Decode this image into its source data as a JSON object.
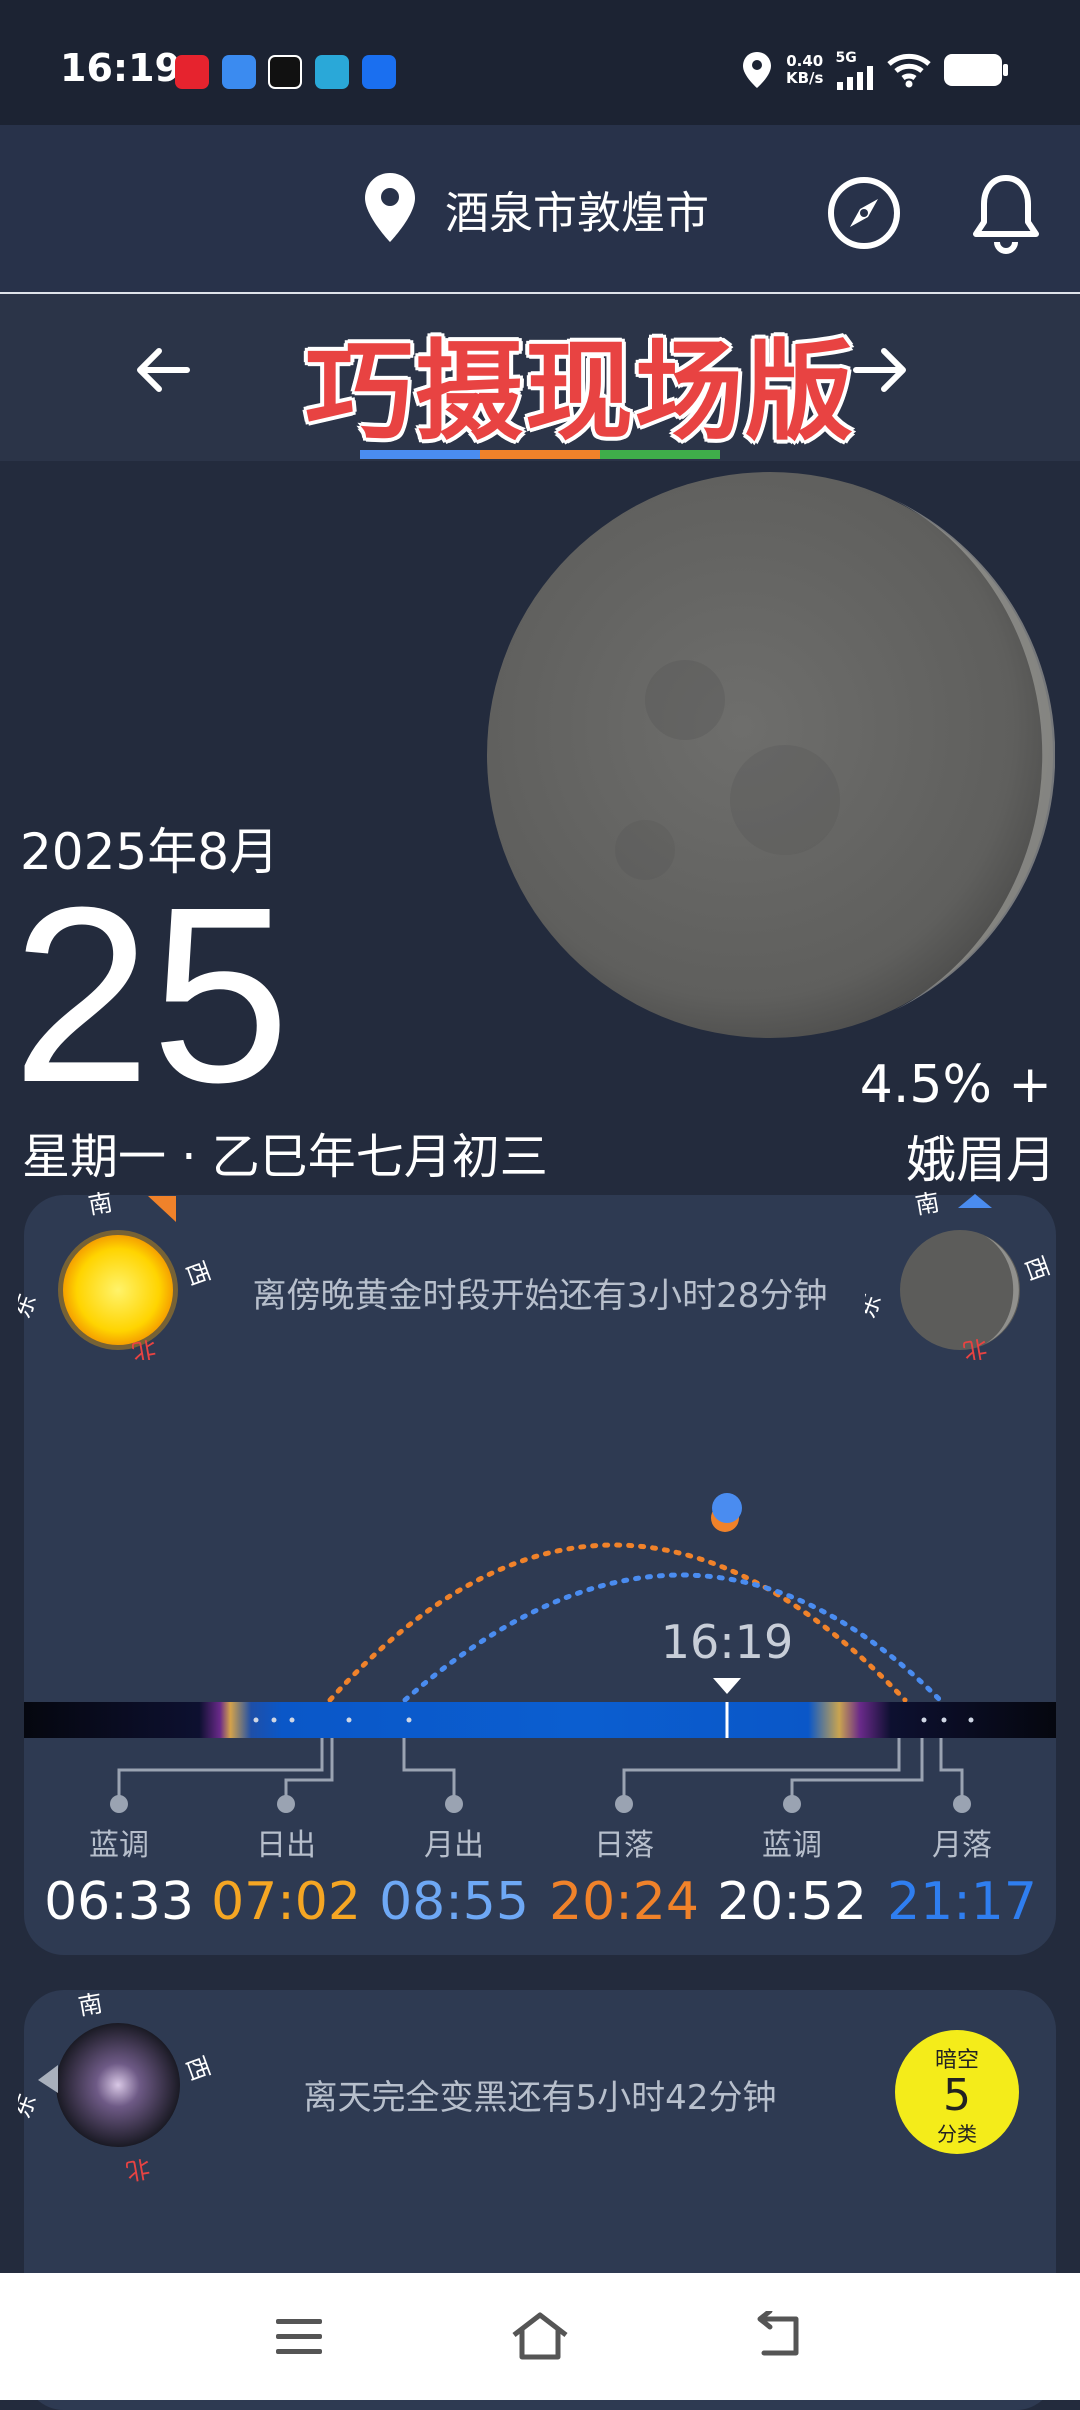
{
  "status_bar": {
    "time": "16:19",
    "net_speed_value": "0.40",
    "net_speed_unit": "KB/s",
    "signal_label": "5G",
    "app_icons": [
      "xiaohongshu-icon",
      "message-icon",
      "capcut-icon",
      "cloud-icon",
      "v-app-icon"
    ]
  },
  "header": {
    "location": "酒泉市敦煌市"
  },
  "banner": {
    "title": "巧摄现场版"
  },
  "hero": {
    "year_month": "2025年8月",
    "day": "25",
    "weekday_lunar": "星期一 · 乙巳年七月初三",
    "illumination": "4.5% +",
    "phase_name": "娥眉月"
  },
  "sun_card": {
    "countdown_message": "离傍晚黄金时段开始还有3小时28分钟",
    "current_time": "16:19",
    "dir_south": "南",
    "dir_west": "西",
    "dir_east": "东",
    "dir_north": "北",
    "events": [
      {
        "name": "蓝调",
        "time": "06:33",
        "color": "#ffffff"
      },
      {
        "name": "日出",
        "time": "07:02",
        "color": "#f5a623"
      },
      {
        "name": "月出",
        "time": "08:55",
        "color": "#6ea8f5"
      },
      {
        "name": "日落",
        "time": "20:24",
        "color": "#f0822a"
      },
      {
        "name": "蓝调",
        "time": "20:52",
        "color": "#ffffff"
      },
      {
        "name": "月落",
        "time": "21:17",
        "color": "#2f7ef0"
      }
    ]
  },
  "dark_card": {
    "countdown_message": "离天完全变黑还有5小时42分钟",
    "badge_top": "暗空",
    "badge_value": "5",
    "badge_bottom": "分类",
    "dir_south": "南",
    "dir_west": "西",
    "dir_east": "东",
    "dir_north": "北"
  },
  "colors": {
    "accent_blue": "#4a8cf0",
    "accent_orange": "#f0822a",
    "accent_green": "#3fae4a",
    "banner_red": "#e84342"
  }
}
